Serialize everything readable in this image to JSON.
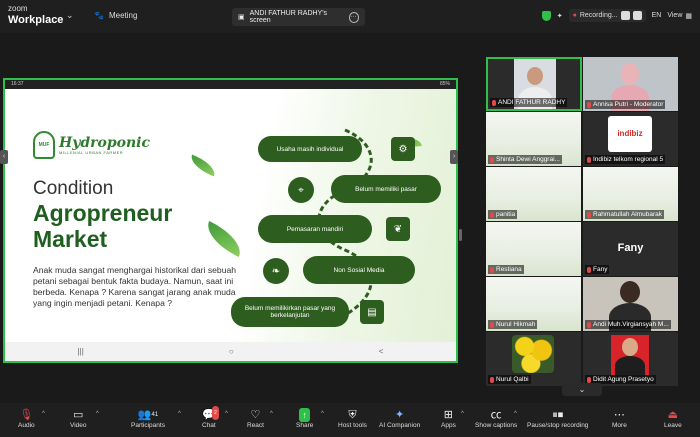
{
  "app": {
    "brand_line1": "zoom",
    "brand_line2": "Workplace"
  },
  "header": {
    "meeting_tab": "Meeting",
    "share_title": "ANDI FATHUR RADHY's screen",
    "recording_label": "Recording...",
    "language": "EN",
    "view_label": "View"
  },
  "device_status": {
    "time": "16:37",
    "battery": "85%"
  },
  "slide": {
    "logo_name": "Hydroponic",
    "logo_tagline": "MILLENIAL URBAN FARMER",
    "title_line1": "Condition",
    "title_line2": "Agropreneur",
    "title_line3": "Market",
    "body": "Anak muda sangat menghargai historikal dari sebuah petani sebagai bentuk fakta budaya. Namun, saat ini berbeda. Kenapa ? Karena sangat jarang anak muda yang ingin menjadi petani. Kenapa ?",
    "points": [
      "Usaha masih individual",
      "Belum memiliki pasar",
      "Pemasaran mandiri",
      "Non Sosial Media",
      "Belum memilikirkan pasar yang berkelanjutan"
    ]
  },
  "phone_nav": {
    "recent": "|||",
    "home": "○",
    "back": "<"
  },
  "participants_gallery": [
    {
      "name": "ANDI FATHUR RADHY",
      "type": "video"
    },
    {
      "name": "Annisa Putri - Moderator",
      "type": "video"
    },
    {
      "name": "Shinta Dewi Anggrai...",
      "type": "slide"
    },
    {
      "name": "Indibiz telkom regional 5",
      "type": "logo",
      "logo_text": "indibiz"
    },
    {
      "name": "panitia",
      "type": "slide"
    },
    {
      "name": "Rahmatullah Almubarak",
      "type": "slide"
    },
    {
      "name": "Restiana",
      "type": "slide"
    },
    {
      "name": "Fany",
      "type": "text",
      "big_label": "Fany"
    },
    {
      "name": "Nurul Hikmah",
      "type": "slide"
    },
    {
      "name": "Andi Muh.Virgiansyah M...",
      "type": "video"
    },
    {
      "name": "Nurul Qalbi",
      "type": "photo"
    },
    {
      "name": "Didit Agung Prasetyo",
      "type": "video"
    }
  ],
  "toolbar": {
    "audio": "Audio",
    "video": "Video",
    "participants": "Participants",
    "participants_count": "41",
    "chat": "Chat",
    "chat_badge": "2",
    "react": "React",
    "share": "Share",
    "host_tools": "Host tools",
    "ai_companion": "AI Companion",
    "apps": "Apps",
    "captions": "Show captions",
    "recording": "Pause/stop recording",
    "more": "More",
    "leave": "Leave"
  },
  "colors": {
    "accent_green": "#2fbf4a",
    "slide_green": "#2e5e1f",
    "record_red": "#e24a4a"
  }
}
